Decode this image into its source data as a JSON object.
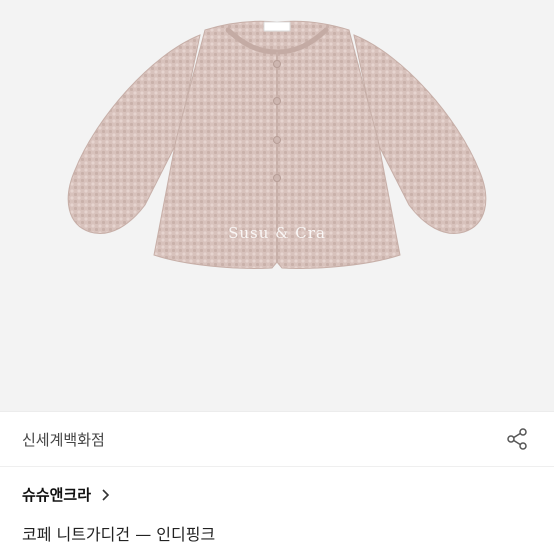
{
  "product_image": {
    "alt": "코페 니트가디건 — 인디핑크",
    "watermark": "Susu & Cra",
    "background_color": "#f3f3f3",
    "garment_color": "#d9c3bd"
  },
  "store": {
    "name": "신세계백화점"
  },
  "share": {
    "icon": "share-icon"
  },
  "brand": {
    "name": "슈슈앤크라",
    "chevron_icon": "chevron-right-icon"
  },
  "product": {
    "title": "코페 니트가디건 — 인디핑크"
  }
}
